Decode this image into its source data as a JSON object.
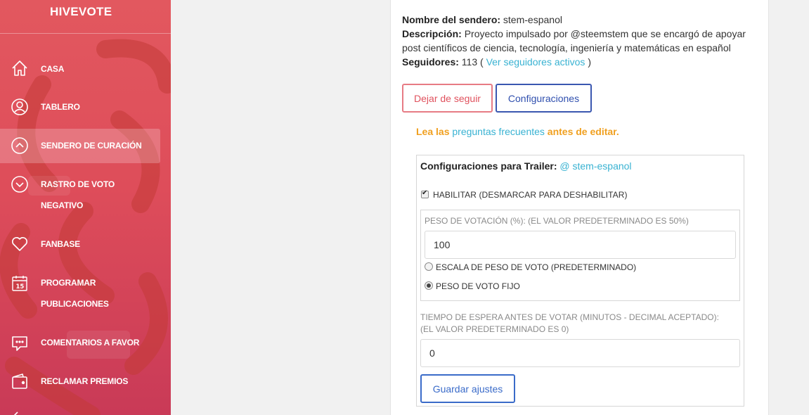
{
  "brand": "HIVEVOTE",
  "colors": {
    "sidebar": "#de4d5a",
    "accent_link": "#38b2d2",
    "warning_orange": "#f0a020",
    "unfollow": "#e0525e",
    "primary": "#2f4fae"
  },
  "nav": {
    "items": [
      {
        "label": "CASA",
        "icon": "home-icon"
      },
      {
        "label": "TABLERO",
        "icon": "user-circle-icon"
      },
      {
        "label": "SENDERO DE CURACIÓN",
        "icon": "chevron-up-circle-icon"
      },
      {
        "label_line1": "RASTRO DE VOTO",
        "label_line2": "NEGATIVO",
        "icon": "chevron-down-circle-icon"
      },
      {
        "label": "FANBASE",
        "icon": "heart-icon"
      },
      {
        "label_line1": "PROGRAMAR",
        "label_line2": "PUBLICACIONES",
        "icon": "calendar-icon",
        "icon_text": "15"
      },
      {
        "label": "COMENTARIOS A FAVOR",
        "icon": "comment-icon"
      },
      {
        "label": "RECLAMAR PREMIOS",
        "icon": "wallet-icon"
      }
    ]
  },
  "trail": {
    "name_label": "Nombre del sendero:",
    "name": "stem-espanol",
    "desc_label": "Descripción:",
    "description": "Proyecto impulsado por @steemstem que se encargó de apoyar post científicos de ciencia, tecnología, ingeniería y matemáticas en español",
    "followers_label": "Seguidores:",
    "followers_count": "113 (",
    "followers_link": "Ver seguidores activos",
    "followers_close": ")"
  },
  "actions": {
    "unfollow": "Dejar de seguir",
    "settings": "Configuraciones"
  },
  "faq": {
    "lead": "Lea las",
    "link": "preguntas frecuentes",
    "tail": "antes de editar."
  },
  "config": {
    "title_label": "Configuraciones para Trailer:",
    "title_link": "@ stem-espanol",
    "enable_label": "HABILITAR (DESMARCAR PARA DESHABILITAR)",
    "enabled": true,
    "weight_label": "PESO DE VOTACIÓN (%): (EL VALOR PREDETERMINADO ES 50%)",
    "weight_value": "100",
    "radio_scale": "ESCALA DE PESO DE VOTO (PREDETERMINADO)",
    "radio_fixed": "PESO DE VOTO FIJO",
    "selected_mode": "fixed",
    "wait_label": "TIEMPO DE ESPERA ANTES DE VOTAR (MINUTOS - DECIMAL ACEPTADO): (EL VALOR PREDETERMINADO ES 0)",
    "wait_value": "0",
    "save": "Guardar ajustes"
  }
}
